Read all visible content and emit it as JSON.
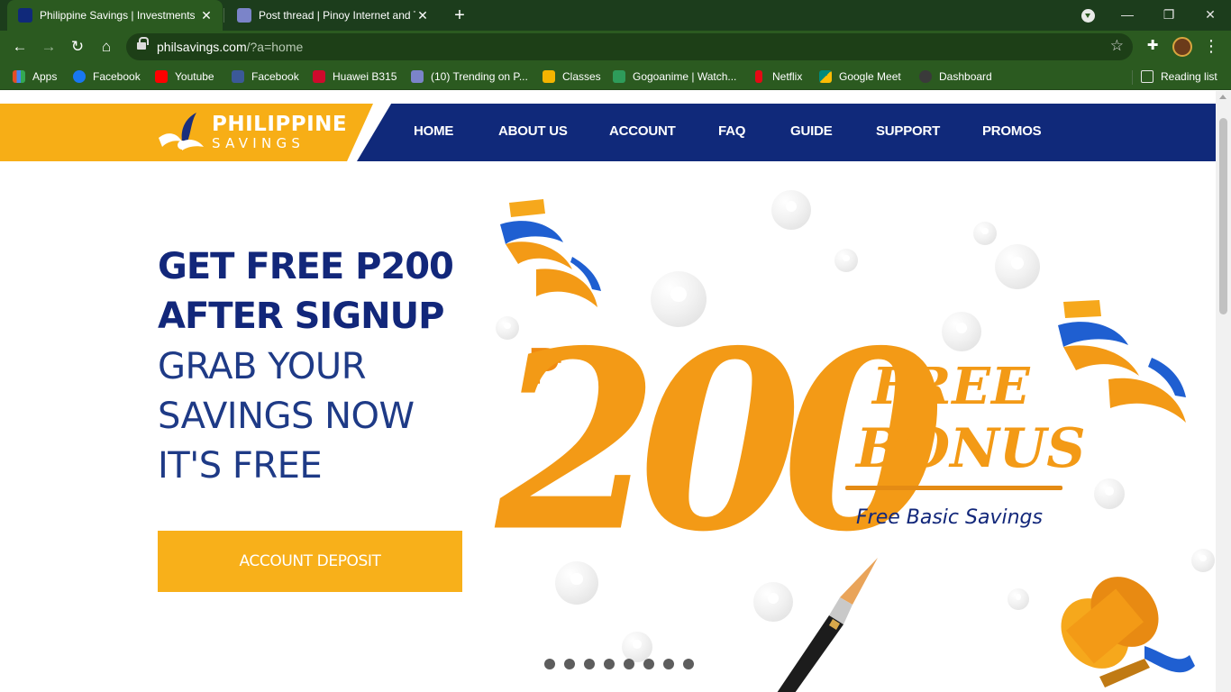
{
  "browser": {
    "tabs": [
      {
        "title": "Philippine Savings | Investments",
        "active": true
      },
      {
        "title": "Post thread | Pinoy Internet and T",
        "active": false
      }
    ],
    "new_tab_symbol": "+",
    "window_controls": [
      "—",
      "❐",
      "✕"
    ],
    "url_host": "philsavings.com",
    "url_path": "/?a=home",
    "bookmarks": [
      {
        "label": "Apps",
        "icon": "apps-grid-icon",
        "color": "#e44d26"
      },
      {
        "label": "Facebook",
        "icon": "facebook-icon",
        "color": "#1877f2"
      },
      {
        "label": "Youtube",
        "icon": "youtube-icon",
        "color": "#ff0000"
      },
      {
        "label": "Facebook",
        "icon": "facebook-icon",
        "color": "#3b5998"
      },
      {
        "label": "Huawei B315",
        "icon": "huawei-icon",
        "color": "#cf0a2c"
      },
      {
        "label": "(10) Trending on P...",
        "icon": "pinoy-forum-icon",
        "color": "#6b6bc4"
      },
      {
        "label": "Classes",
        "icon": "classroom-icon",
        "color": "#f4b400"
      },
      {
        "label": "Gogoanime | Watch...",
        "icon": "gogoanime-icon",
        "color": "#2e9c5a"
      },
      {
        "label": "Netflix",
        "icon": "netflix-icon",
        "color": "#e50914"
      },
      {
        "label": "Google Meet",
        "icon": "google-meet-icon",
        "color": "#00897b"
      },
      {
        "label": "Dashboard",
        "icon": "dashboard-avatar-icon",
        "color": "#444444"
      }
    ],
    "reading_list": "Reading list"
  },
  "site": {
    "logo_line1": "PHILIPPINE",
    "logo_line2": "SAVINGS",
    "nav": [
      "HOME",
      "ABOUT US",
      "ACCOUNT",
      "FAQ",
      "GUIDE",
      "SUPPORT",
      "PROMOS"
    ],
    "hero": {
      "line1": "GET FREE P200",
      "line2": "AFTER SIGNUP",
      "line3": "GRAB YOUR",
      "line4": "SAVINGS NOW",
      "line5": "IT'S FREE",
      "cta": "ACCOUNT DEPOSIT"
    },
    "banner": {
      "currency": "₱",
      "amount": "200",
      "free": "FREE",
      "bonus": "BONUS",
      "subtitle": "Free Basic Savings"
    },
    "carousel": {
      "total": 8,
      "current": 1
    }
  },
  "colors": {
    "brand_orange": "#f7ae16",
    "brand_navy": "#10297a",
    "chrome_green": "#2b5a20"
  }
}
